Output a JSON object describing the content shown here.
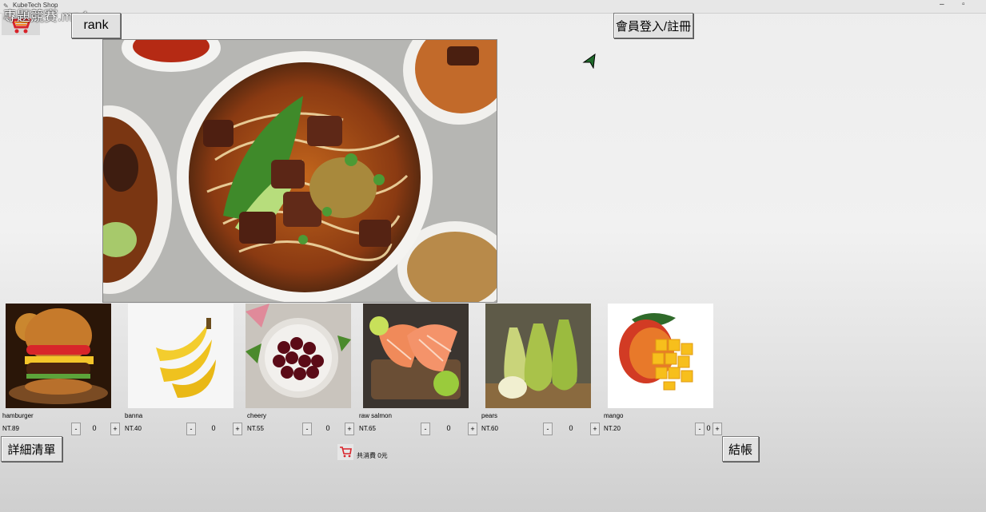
{
  "window": {
    "app_title": "KubeTech Shop",
    "minimize": "–",
    "maximize": "▫"
  },
  "video_title": "專題競賽.mp4",
  "header": {
    "rank_label": "rank",
    "login_label": "會員登入/註冊"
  },
  "products": [
    {
      "name": "hamburger",
      "price": "NT.89",
      "qty": "0",
      "minus": "-",
      "plus": "+"
    },
    {
      "name": "banna",
      "price": "NT.40",
      "qty": "0",
      "minus": "-",
      "plus": "+"
    },
    {
      "name": "cheery",
      "price": "NT.55",
      "qty": "0",
      "minus": "-",
      "plus": "+"
    },
    {
      "name": "raw salmon",
      "price": "NT.65",
      "qty": "0",
      "minus": "-",
      "plus": "+"
    },
    {
      "name": "pears",
      "price": "NT.60",
      "qty": "0",
      "minus": "-",
      "plus": "+"
    },
    {
      "name": "mango",
      "price": "NT.20",
      "qty": "0",
      "minus": "-",
      "plus": "+"
    }
  ],
  "footer": {
    "details_label": "詳細清單",
    "total_text": "共消費 0元",
    "checkout_label": "結帳"
  },
  "icons": {
    "logo": "shopping-cart-logo-icon",
    "cursor": "mouse-pointer-icon"
  }
}
